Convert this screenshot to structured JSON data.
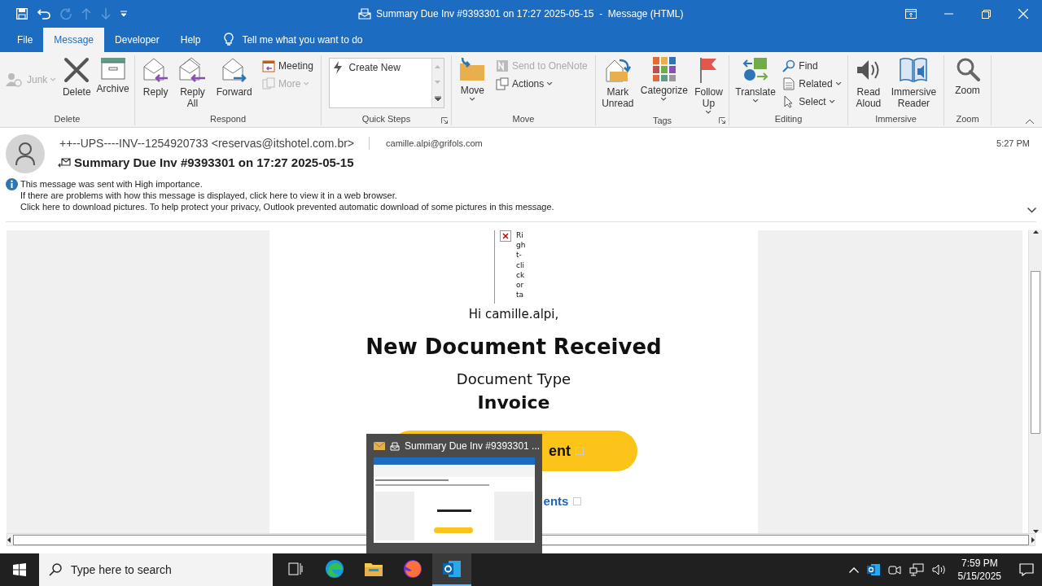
{
  "window": {
    "title": "Summary Due Inv #9393301 on 17:27 2025-05-15  -  Message (HTML)"
  },
  "tabs": [
    {
      "label": "File",
      "selected": false
    },
    {
      "label": "Message",
      "selected": true
    },
    {
      "label": "Developer",
      "selected": false
    },
    {
      "label": "Help",
      "selected": false
    }
  ],
  "tell_me": {
    "placeholder": "Tell me what you want to do"
  },
  "ribbon": {
    "groups": [
      {
        "label": "Delete",
        "items": [
          {
            "kind": "small",
            "lines": [
              "Junk"
            ],
            "disabled": true,
            "dropdown": true
          },
          {
            "kind": "large",
            "lines": [
              "Delete"
            ],
            "disabled": false,
            "dropdown": false
          },
          {
            "kind": "large",
            "lines": [
              "Archive"
            ],
            "disabled": false,
            "dropdown": false
          }
        ]
      },
      {
        "label": "Respond",
        "items": [
          {
            "kind": "large",
            "lines": [
              "Reply"
            ],
            "disabled": false,
            "dropdown": false
          },
          {
            "kind": "large",
            "lines": [
              "Reply",
              "All"
            ],
            "disabled": false,
            "dropdown": false
          },
          {
            "kind": "large",
            "lines": [
              "Forward"
            ],
            "disabled": false,
            "dropdown": false
          },
          {
            "kind": "stack",
            "items": [
              {
                "kind": "small",
                "lines": [
                  "Meeting"
                ],
                "disabled": false,
                "dropdown": false
              },
              {
                "kind": "small",
                "lines": [
                  "More"
                ],
                "disabled": true,
                "dropdown": true
              }
            ]
          }
        ]
      },
      {
        "label": "Quick Steps",
        "launcher": true,
        "items": [
          {
            "kind": "gallery",
            "entries": [
              "Create New"
            ]
          }
        ]
      },
      {
        "label": "Move",
        "items": [
          {
            "kind": "large",
            "lines": [
              "Move"
            ],
            "disabled": false,
            "dropdown": true
          },
          {
            "kind": "stack",
            "items": [
              {
                "kind": "small",
                "lines": [
                  "Send to OneNote"
                ],
                "disabled": true,
                "dropdown": false
              },
              {
                "kind": "small",
                "lines": [
                  "Actions"
                ],
                "disabled": false,
                "dropdown": true
              }
            ]
          }
        ]
      },
      {
        "label": "Tags",
        "launcher": true,
        "items": [
          {
            "kind": "large",
            "lines": [
              "Mark",
              "Unread"
            ],
            "disabled": false,
            "dropdown": false
          },
          {
            "kind": "large",
            "lines": [
              "Categorize"
            ],
            "disabled": false,
            "dropdown": true
          },
          {
            "kind": "large",
            "lines": [
              "Follow",
              "Up"
            ],
            "disabled": false,
            "dropdown": true
          }
        ]
      },
      {
        "label": "Editing",
        "items": [
          {
            "kind": "large",
            "lines": [
              "Translate"
            ],
            "disabled": false,
            "dropdown": true
          },
          {
            "kind": "stack",
            "items": [
              {
                "kind": "small",
                "lines": [
                  "Find"
                ],
                "disabled": false,
                "dropdown": false
              },
              {
                "kind": "small",
                "lines": [
                  "Related"
                ],
                "disabled": false,
                "dropdown": true
              },
              {
                "kind": "small",
                "lines": [
                  "Select"
                ],
                "disabled": false,
                "dropdown": true
              }
            ]
          }
        ]
      },
      {
        "label": "Immersive",
        "items": [
          {
            "kind": "large",
            "lines": [
              "Read",
              "Aloud"
            ],
            "disabled": false,
            "dropdown": false
          },
          {
            "kind": "large",
            "lines": [
              "Immersive",
              "Reader"
            ],
            "disabled": false,
            "dropdown": false
          }
        ]
      },
      {
        "label": "Zoom",
        "items": [
          {
            "kind": "large",
            "lines": [
              "Zoom"
            ],
            "disabled": false,
            "dropdown": false
          }
        ]
      }
    ]
  },
  "message": {
    "from": "++--UPS----INV--1254920733 <reservas@itshotel.com.br>",
    "to": "camille.alpi@grifols.com",
    "time": "5:27 PM",
    "subject": "Summary Due Inv #9393301 on 17:27 2025-05-15",
    "info": [
      "This message was sent with High importance.",
      "If there are problems with how this message is displayed, click here to view it in a web browser.",
      "Click here to download pictures. To help protect your privacy, Outlook prevented automatic download of some pictures in this message."
    ]
  },
  "body": {
    "broken_image": {
      "lines": [
        "Ri",
        "gh",
        "t-",
        "cli",
        "ck",
        "or",
        "ta"
      ]
    },
    "greeting": "Hi camille.alpi,",
    "heading": "New Document Received",
    "type_label": "Document Type",
    "type_value": "Invoice",
    "button": "ent",
    "link": "ents"
  },
  "preview": {
    "title": "Summary Due Inv #9393301 ..."
  },
  "taskbar": {
    "search": {
      "placeholder": "Type here to search"
    },
    "apps": [
      {
        "selected": false
      },
      {
        "selected": false
      },
      {
        "selected": false
      },
      {
        "selected": false
      },
      {
        "selected": true
      }
    ],
    "time": "7:59 PM",
    "date": "5/15/2025"
  }
}
